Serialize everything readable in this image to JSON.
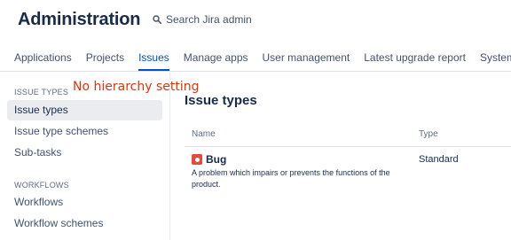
{
  "header": {
    "title": "Administration",
    "search_label": "Search Jira admin"
  },
  "tabs": [
    {
      "label": "Applications",
      "active": false
    },
    {
      "label": "Projects",
      "active": false
    },
    {
      "label": "Issues",
      "active": true
    },
    {
      "label": "Manage apps",
      "active": false
    },
    {
      "label": "User management",
      "active": false
    },
    {
      "label": "Latest upgrade report",
      "active": false
    },
    {
      "label": "System",
      "active": false
    }
  ],
  "sidebar": {
    "sections": [
      {
        "label": "ISSUE TYPES",
        "items": [
          {
            "label": "Issue types",
            "selected": true
          },
          {
            "label": "Issue type schemes",
            "selected": false
          },
          {
            "label": "Sub-tasks",
            "selected": false
          }
        ]
      },
      {
        "label": "WORKFLOWS",
        "items": [
          {
            "label": "Workflows",
            "selected": false
          },
          {
            "label": "Workflow schemes",
            "selected": false
          }
        ]
      }
    ]
  },
  "annotation": "No hierarchy setting",
  "main": {
    "title": "Issue types",
    "columns": [
      "Name",
      "Type"
    ],
    "rows": [
      {
        "name": "Bug",
        "icon": "bug-icon",
        "description": "A problem which impairs or prevents the functions of the product.",
        "type": "Standard"
      }
    ]
  },
  "colors": {
    "accent": "#0052cc",
    "bug": "#e5493a",
    "annotation": "#de350b"
  }
}
